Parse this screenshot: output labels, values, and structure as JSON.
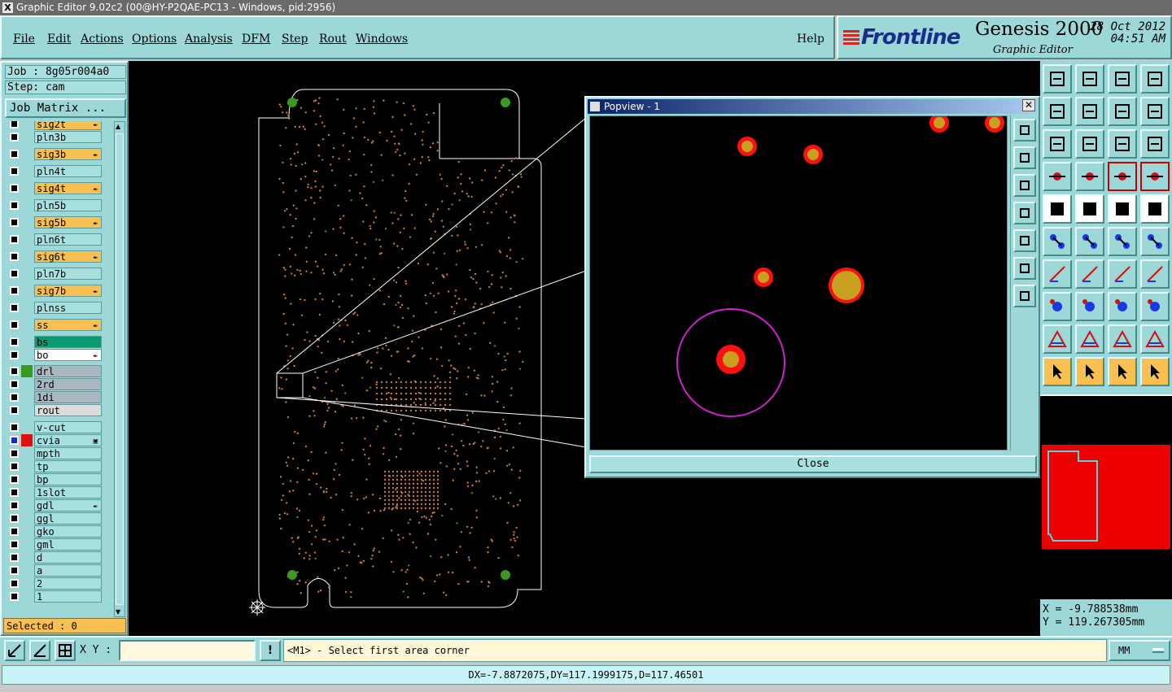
{
  "window": {
    "title": "Graphic Editor 9.02c2 (00@HY-P2QAE-PC13 - Windows, pid:2956)"
  },
  "menu": {
    "file": "File",
    "edit": "Edit",
    "actions": "Actions",
    "options": "Options",
    "analysis": "Analysis",
    "dfm": "DFM",
    "step": "Step",
    "rout": "Rout",
    "windows": "Windows",
    "help": "Help"
  },
  "brand": {
    "logo": "Frontline",
    "product": "Genesis 2000",
    "subtitle": "Graphic Editor",
    "date": "28 Oct 2012",
    "time": "04:51 AM"
  },
  "job": {
    "job_label": "Job : 8g05r004a0",
    "step_label": "Step: cam",
    "matrix_button": "Job Matrix ..."
  },
  "layers": [
    {
      "name": "sig2t",
      "bg": "#f8c050",
      "icon": "✒"
    },
    {
      "name": "pln3b",
      "bg": "#a8e0e0",
      "icon": ""
    },
    {
      "name": "sig3b",
      "bg": "#f8c050",
      "icon": "✒"
    },
    {
      "name": "pln4t",
      "bg": "#a8e0e0",
      "icon": ""
    },
    {
      "name": "sig4t",
      "bg": "#f8c050",
      "icon": "✒"
    },
    {
      "name": "pln5b",
      "bg": "#a8e0e0",
      "icon": ""
    },
    {
      "name": "sig5b",
      "bg": "#f8c050",
      "icon": "✒"
    },
    {
      "name": "pln6t",
      "bg": "#a8e0e0",
      "icon": ""
    },
    {
      "name": "sig6t",
      "bg": "#f8c050",
      "icon": "✒"
    },
    {
      "name": "pln7b",
      "bg": "#a8e0e0",
      "icon": ""
    },
    {
      "name": "sig7b",
      "bg": "#f8c050",
      "icon": "✒"
    },
    {
      "name": "plnss",
      "bg": "#a8e0e0",
      "icon": ""
    },
    {
      "name": "ss",
      "bg": "#f8c050",
      "icon": "✒"
    },
    {
      "name": "bs",
      "bg": "#0a9a70",
      "icon": ""
    },
    {
      "name": "bo",
      "bg": "#ffffff",
      "icon": "✒"
    },
    {
      "name": "drl",
      "bg": "#a8b8c0",
      "icon": "",
      "swatch": "#3a9a20"
    },
    {
      "name": "2rd",
      "bg": "#a8b8c0",
      "icon": ""
    },
    {
      "name": "1di",
      "bg": "#a8b8c0",
      "icon": ""
    },
    {
      "name": "rout",
      "bg": "#dcdcdc",
      "icon": ""
    },
    {
      "name": "v-cut",
      "bg": "#a8e0e0",
      "icon": ""
    },
    {
      "name": "cvia",
      "bg": "#a8e0e0",
      "icon": "▣",
      "swatch": "#e01010",
      "active": true
    },
    {
      "name": "mpth",
      "bg": "#a8e0e0",
      "icon": ""
    },
    {
      "name": "tp",
      "bg": "#a8e0e0",
      "icon": ""
    },
    {
      "name": "bp",
      "bg": "#a8e0e0",
      "icon": ""
    },
    {
      "name": "1slot",
      "bg": "#a8e0e0",
      "icon": ""
    },
    {
      "name": "gdl",
      "bg": "#a8e0e0",
      "icon": "✒"
    },
    {
      "name": "ggl",
      "bg": "#a8e0e0",
      "icon": ""
    },
    {
      "name": "gko",
      "bg": "#a8e0e0",
      "icon": ""
    },
    {
      "name": "gml",
      "bg": "#a8e0e0",
      "icon": ""
    },
    {
      "name": "d",
      "bg": "#a8e0e0",
      "icon": ""
    },
    {
      "name": "a",
      "bg": "#a8e0e0",
      "icon": ""
    },
    {
      "name": "2",
      "bg": "#a8e0e0",
      "icon": ""
    },
    {
      "name": "1",
      "bg": "#a8e0e0",
      "icon": ""
    }
  ],
  "selection": {
    "label": "Selected : 0"
  },
  "popview": {
    "title": "Popview - 1",
    "close_button": "Close",
    "close_x": "✕"
  },
  "coords": {
    "x": "X = -9.788538mm",
    "y": "Y = 119.267305mm"
  },
  "input": {
    "xy_label": "X Y :",
    "xy_value": "",
    "info_button": "!"
  },
  "prompt": "<M1> - Select first area corner",
  "units": "MM",
  "status": "DX=-7.8872075,DY=117.1999175,D=117.46501",
  "colors": {
    "pad_outer": "#ff1010",
    "pad_inner": "#c8a020",
    "highlight": "#d020d0",
    "board_outline": "#ffffff",
    "via": "#c87840"
  }
}
